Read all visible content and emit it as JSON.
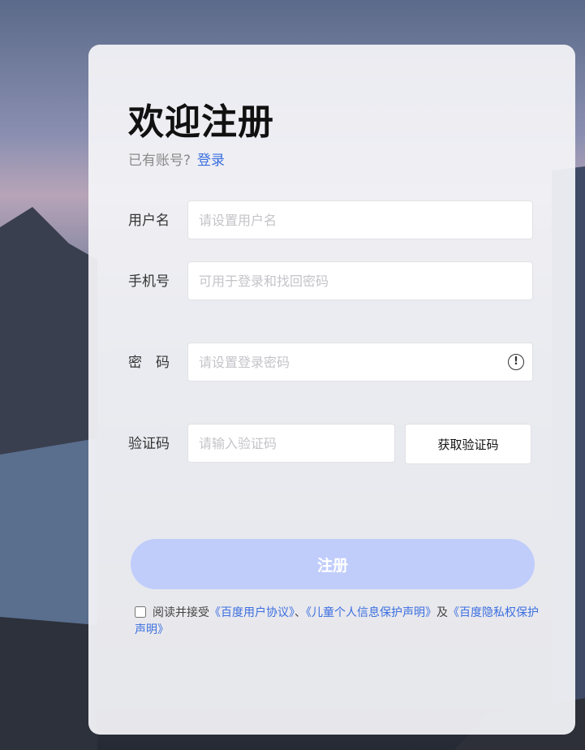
{
  "header": {
    "title": "欢迎注册",
    "have_account": "已有账号?",
    "login_link": "登录"
  },
  "fields": {
    "username": {
      "label": "用户名",
      "placeholder": "请设置用户名",
      "value": ""
    },
    "phone": {
      "label": "手机号",
      "placeholder": "可用于登录和找回密码",
      "value": ""
    },
    "password": {
      "label": "密　码",
      "placeholder": "请设置登录密码",
      "value": "",
      "icon": "info-icon"
    },
    "code": {
      "label": "验证码",
      "placeholder": "请输入验证码",
      "value": "",
      "button_label": "获取验证码"
    }
  },
  "submit_label": "注册",
  "agreement": {
    "checked": false,
    "prefix": "阅读并接受",
    "doc1": "《百度用户协议》",
    "sep": "、",
    "doc2": "《儿童个人信息保护声明》",
    "and": "及",
    "doc3": "《百度隐私权保护声明》"
  },
  "colors": {
    "accent": "#3b6fe0",
    "submit_disabled": "#c0cdfb"
  }
}
